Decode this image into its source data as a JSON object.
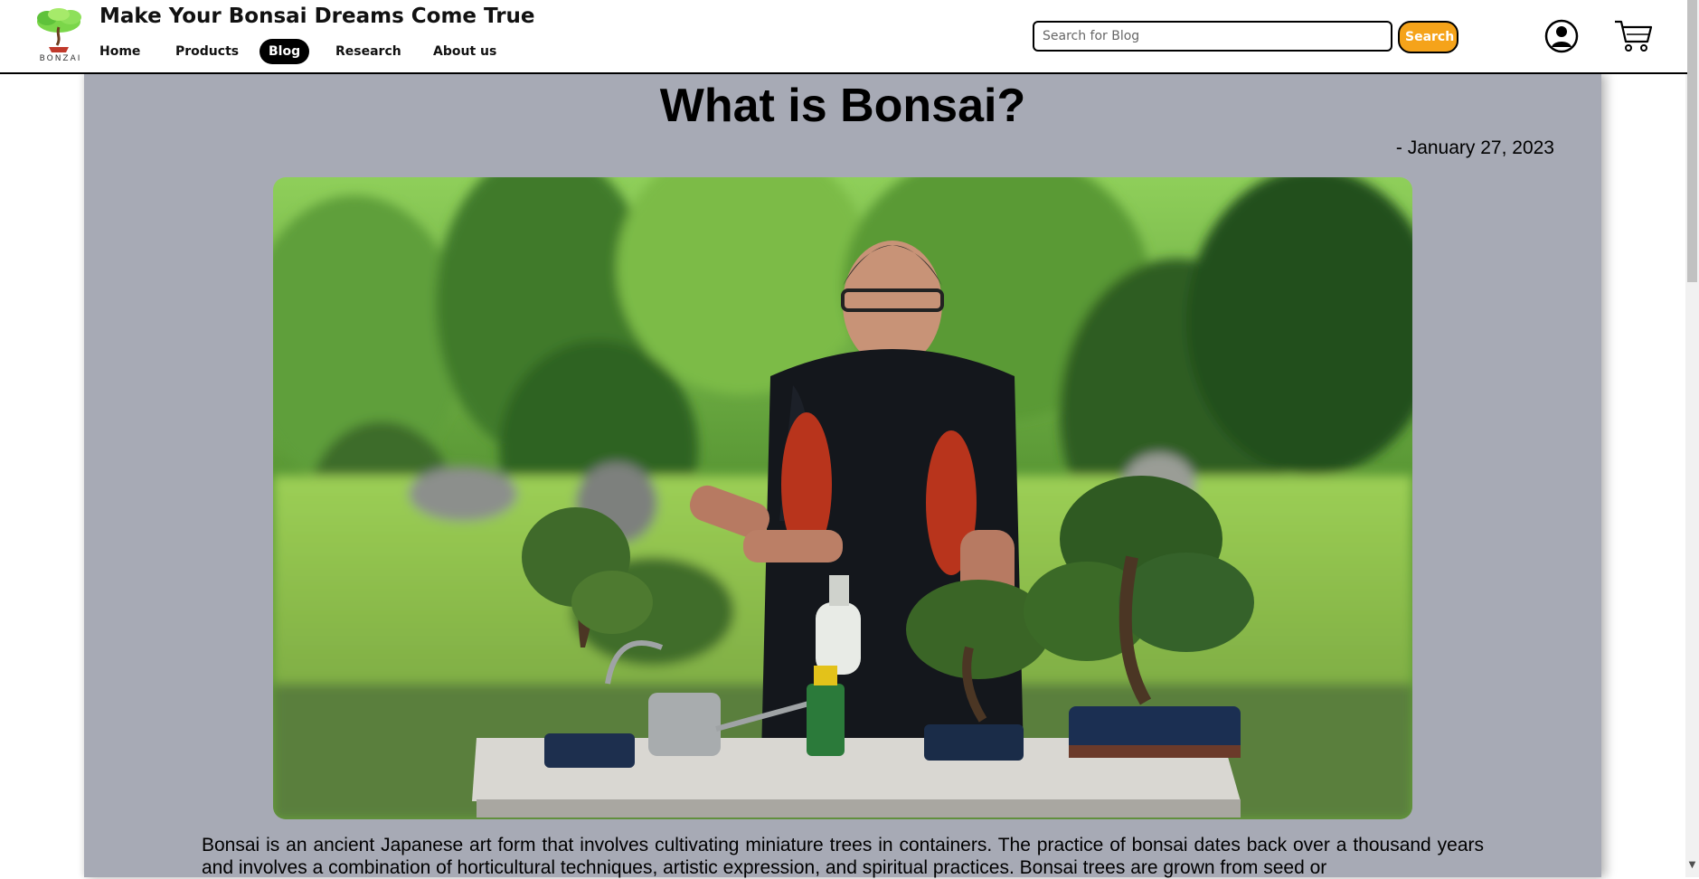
{
  "brand": {
    "logo_text": "BONZAI",
    "title": "Make Your Bonsai Dreams Come True"
  },
  "nav": {
    "items": [
      {
        "label": "Home"
      },
      {
        "label": "Products"
      },
      {
        "label": "Blog",
        "active": true
      },
      {
        "label": "Research"
      },
      {
        "label": "About us"
      }
    ]
  },
  "search": {
    "placeholder": "Search for Blog",
    "button_label": "Search"
  },
  "icons": {
    "account": "user-account-icon",
    "cart": "shopping-cart-icon"
  },
  "post": {
    "title": "What is Bonsai?",
    "date": "- January 27, 2023",
    "body": "Bonsai is an ancient Japanese art form that involves cultivating miniature trees in containers. The practice of bonsai dates back over a thousand years and involves a combination of horticultural techniques, artistic expression, and spiritual practices. Bonsai trees are grown from seed or"
  },
  "colors": {
    "accent": "#f5a31a",
    "card_background": "#a7aab5",
    "nav_active": "#000000"
  }
}
